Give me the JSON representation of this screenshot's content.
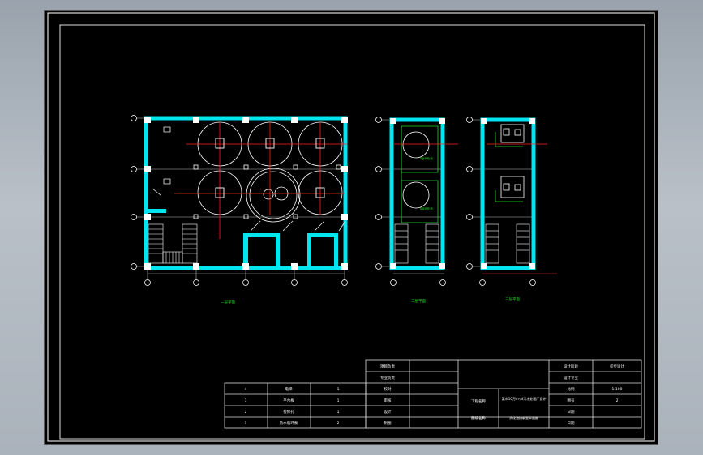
{
  "drawing": {
    "plan_labels": [
      "一层平面",
      "二层平面",
      "三层平面"
    ],
    "grid_axes": {
      "plan1_rows": [
        "A",
        "B",
        "C",
        "D"
      ],
      "plan1_cols": [
        "1",
        "2",
        "3",
        "4",
        "5"
      ],
      "plan2_rows": [
        "A",
        "B",
        "C",
        "D"
      ],
      "plan2_cols": [
        "1",
        "2"
      ],
      "plan3_rows": [
        "A",
        "B",
        "C",
        "D"
      ],
      "plan3_cols": [
        "1",
        "2"
      ]
    },
    "tank_labels": [
      "Ⅱ级消化池",
      "Ⅱ级消化池"
    ]
  },
  "parts_table": {
    "rows": [
      {
        "no": "4",
        "name": "电梯",
        "qty": "1"
      },
      {
        "no": "3",
        "name": "平台板",
        "qty": "1"
      },
      {
        "no": "2",
        "name": "检修孔",
        "qty": "1"
      },
      {
        "no": "1",
        "name": "热水循环泵",
        "qty": "2"
      }
    ]
  },
  "title_block": {
    "roles": [
      "项目负责",
      "专业负责",
      "校对",
      "审核",
      "设计",
      "制图"
    ],
    "project_label": "工程名称",
    "project_name": "某市10万m³/d污水处理厂设计",
    "drawing_label": "图纸名称",
    "drawing_name": "消化池控制室平面图",
    "right_labels": [
      "设计阶段",
      "设计专业",
      "比例",
      "图号",
      "日期",
      "日期"
    ],
    "right_values": [
      "初步设计",
      "",
      "1:100",
      "2",
      "",
      ""
    ]
  },
  "colors": {
    "wall": "#00e5ee",
    "line": "#ffffff",
    "axis": "#ff2020",
    "equipment": "#22dd22",
    "background": "#000000",
    "frame": "#9a9a9a"
  }
}
